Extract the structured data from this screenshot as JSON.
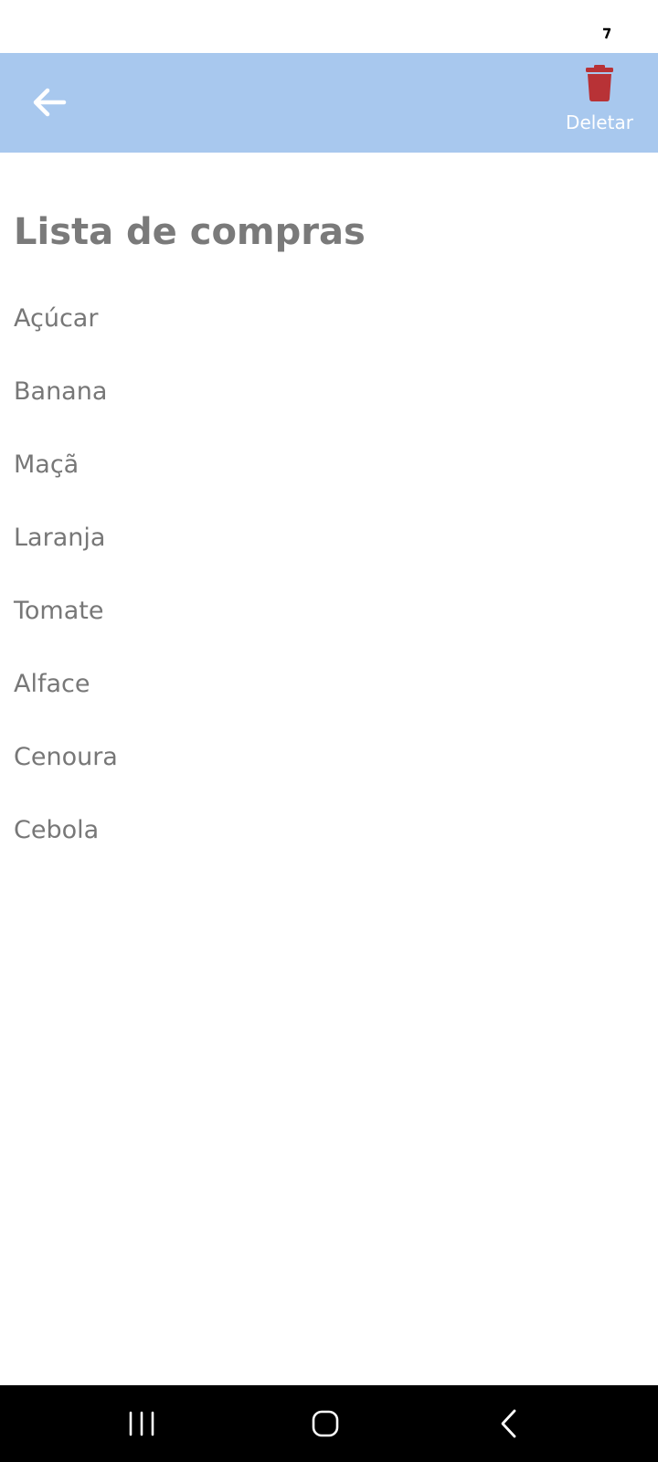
{
  "app_bar": {
    "back_icon": "arrow-left-icon",
    "delete_icon": "trash-icon",
    "delete_label": "Deletar",
    "background_color": "#a8c8ee",
    "delete_icon_color": "#b83236"
  },
  "page": {
    "title": "Lista de compras"
  },
  "items": [
    {
      "label": "Açúcar"
    },
    {
      "label": "Banana"
    },
    {
      "label": "Maçã"
    },
    {
      "label": "Laranja"
    },
    {
      "label": "Tomate"
    },
    {
      "label": "Alface"
    },
    {
      "label": "Cenoura"
    },
    {
      "label": "Cebola"
    }
  ],
  "nav_bar": {
    "recents_icon": "recents-icon",
    "home_icon": "home-icon",
    "back_icon": "back-chevron-icon"
  }
}
